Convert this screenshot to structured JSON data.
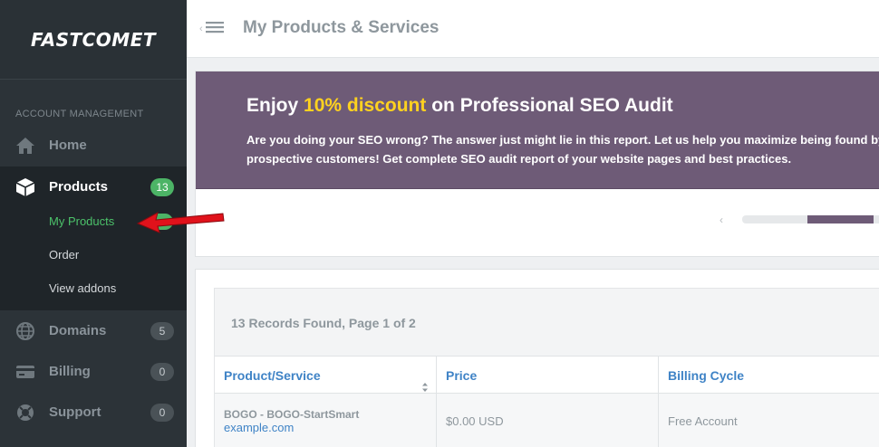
{
  "brand": {
    "logo_text": "FASTCOMET"
  },
  "sidebar": {
    "section_label": "ACCOUNT MANAGEMENT",
    "items": [
      {
        "label": "Home",
        "icon": "home-icon"
      },
      {
        "label": "Products",
        "icon": "box-icon",
        "badge": "13",
        "active": true
      },
      {
        "label": "Domains",
        "icon": "globe-icon",
        "badge": "5"
      },
      {
        "label": "Billing",
        "icon": "credit-card-icon",
        "badge": "0"
      },
      {
        "label": "Support",
        "icon": "lifebuoy-icon",
        "badge": "0"
      }
    ],
    "sub_items": [
      {
        "label": "My Products",
        "current": true
      },
      {
        "label": "Order"
      },
      {
        "label": "View addons"
      }
    ]
  },
  "header": {
    "title": "My Products & Services"
  },
  "promo": {
    "title_prefix": "Enjoy ",
    "title_highlight": "10% discount",
    "title_suffix": " on Professional SEO Audit",
    "line1": "Are you doing your SEO wrong? The answer just might lie in this report. Let us help you maximize being found by",
    "line2": "prospective customers! Get complete SEO audit report of your website pages and best practices.",
    "carousel_prev": "‹"
  },
  "records": {
    "summary": "13 Records Found, Page 1 of 2",
    "columns": [
      "Product/Service",
      "Price",
      "Billing Cycle"
    ],
    "rows": [
      {
        "product": "BOGO - BOGO-StartSmart",
        "domain": "example.com",
        "price": "$0.00 USD",
        "billing_cycle": "Free Account"
      }
    ]
  },
  "colors": {
    "sidebar_bg": "#2c3338",
    "accent_green": "#4cb466",
    "promo_bg": "#6e5b77",
    "highlight_yellow": "#ffd21f",
    "link_blue": "#3f83c6",
    "arrow_red": "#e0121b"
  }
}
